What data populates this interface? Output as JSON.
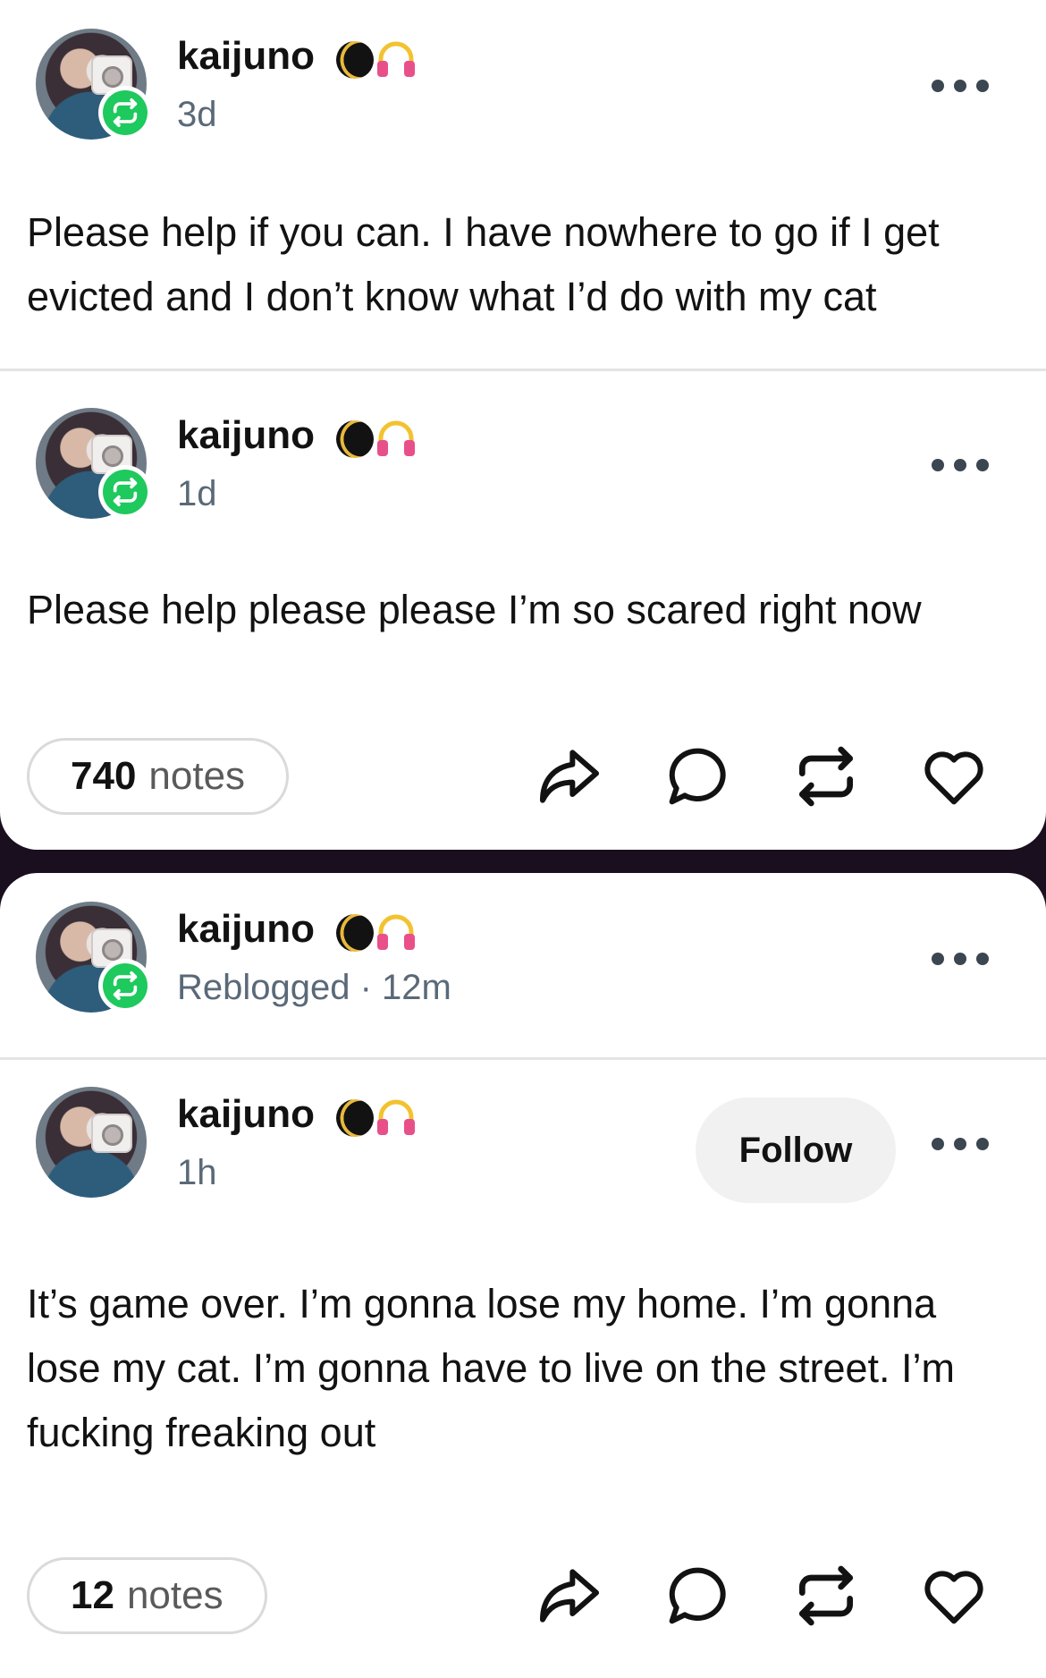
{
  "posts": [
    {
      "username": "kaijuno",
      "meta": "3d",
      "body": "Please help if you can. I have nowhere to go if I get evicted and I don’t know what I’d do with my cat"
    },
    {
      "username": "kaijuno",
      "meta": "1d",
      "body": "Please help please please I’m so scared right now",
      "notes_count": "740",
      "notes_label": "notes"
    },
    {
      "username": "kaijuno",
      "meta": "Reblogged · 12m"
    },
    {
      "username": "kaijuno",
      "meta": "1h",
      "follow_label": "Follow",
      "body": "It’s game over. I’m gonna lose my home. I’m gonna lose my cat. I’m gonna have to live on the street. I’m fucking freaking out",
      "notes_count": "12",
      "notes_label": "notes"
    }
  ],
  "icons": {
    "status_emojis": [
      "new-moon-icon",
      "headphones-icon"
    ],
    "actions": [
      "share-icon",
      "reply-icon",
      "reblog-icon",
      "like-icon"
    ],
    "reblog_badge": "reblog-icon",
    "more": "more-options-icon"
  },
  "colors": {
    "reblog_green": "#1ec95d",
    "meta_text": "#5a6978",
    "background_dark": "#1a0f1e"
  }
}
